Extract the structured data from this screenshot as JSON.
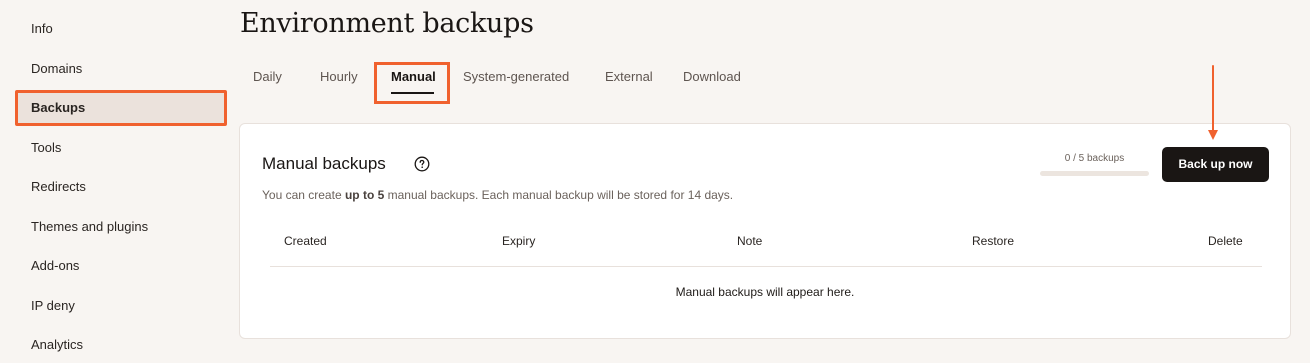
{
  "sidebar": {
    "items": [
      {
        "label": "Info"
      },
      {
        "label": "Domains"
      },
      {
        "label": "Backups"
      },
      {
        "label": "Tools"
      },
      {
        "label": "Redirects"
      },
      {
        "label": "Themes and plugins"
      },
      {
        "label": "Add-ons"
      },
      {
        "label": "IP deny"
      },
      {
        "label": "Analytics"
      }
    ],
    "active": "Backups"
  },
  "page": {
    "title": "Environment backups"
  },
  "tabs": [
    {
      "label": "Daily"
    },
    {
      "label": "Hourly"
    },
    {
      "label": "Manual"
    },
    {
      "label": "System-generated"
    },
    {
      "label": "External"
    },
    {
      "label": "Download"
    }
  ],
  "active_tab": "Manual",
  "card": {
    "title": "Manual backups",
    "desc_prefix": "You can create ",
    "desc_bold": "up to 5",
    "desc_suffix": " manual backups. Each manual backup will be stored for 14 days.",
    "count_label": "0 / 5 backups",
    "count_used": 0,
    "count_max": 5,
    "button_label": "Back up now",
    "columns": [
      "Created",
      "Expiry",
      "Note",
      "Restore",
      "Delete"
    ],
    "empty_text": "Manual backups will appear here."
  },
  "colors": {
    "accent": "#f0612e",
    "button_bg": "#1a1614",
    "page_bg": "#f8f5f2"
  }
}
